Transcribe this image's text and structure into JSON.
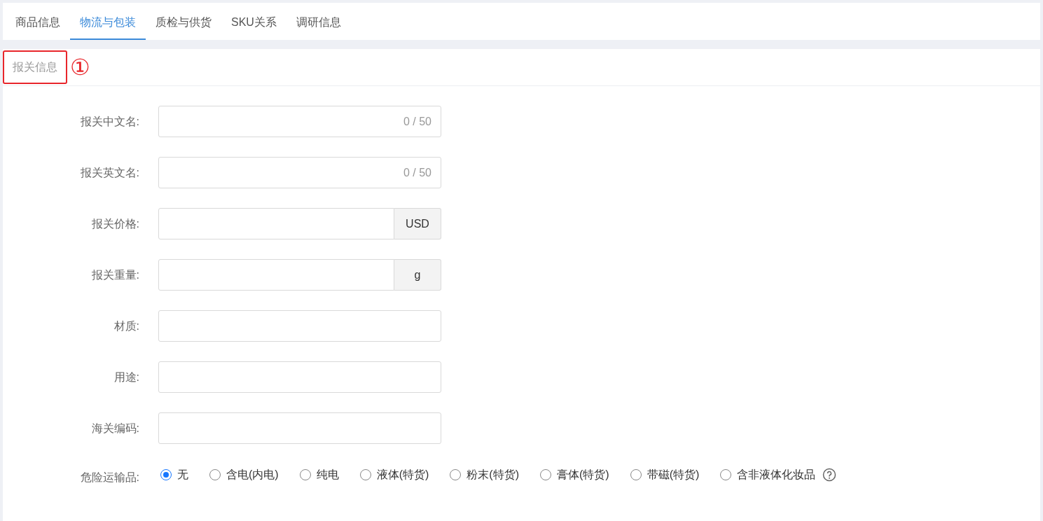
{
  "tabs": [
    {
      "label": "商品信息",
      "selected": false
    },
    {
      "label": "物流与包装",
      "selected": true
    },
    {
      "label": "质检与供货",
      "selected": false
    },
    {
      "label": "SKU关系",
      "selected": false
    },
    {
      "label": "调研信息",
      "selected": false
    }
  ],
  "section": {
    "title": "报关信息",
    "highlighted": true,
    "annotation": "①"
  },
  "fields": [
    {
      "label": "报关中文名:",
      "kind": "counter",
      "counter": "0 / 50"
    },
    {
      "label": "报关英文名:",
      "kind": "counter",
      "counter": "0 / 50"
    },
    {
      "label": "报关价格:",
      "kind": "addon",
      "suffix": "USD"
    },
    {
      "label": "报关重量:",
      "kind": "addon",
      "suffix": "g"
    },
    {
      "label": "材质:",
      "kind": "plain"
    },
    {
      "label": "用途:",
      "kind": "plain"
    },
    {
      "label": "海关编码:",
      "kind": "plain"
    }
  ],
  "dangerous_goods": {
    "label": "危险运输品:",
    "options": [
      {
        "label": "无",
        "selected": true
      },
      {
        "label": "含电(内电)",
        "selected": false
      },
      {
        "label": "纯电",
        "selected": false
      },
      {
        "label": "液体(特货)",
        "selected": false
      },
      {
        "label": "粉末(特货)",
        "selected": false
      },
      {
        "label": "膏体(特货)",
        "selected": false
      },
      {
        "label": "带磁(特货)",
        "selected": false
      },
      {
        "label": "含非液体化妆品",
        "selected": false
      }
    ]
  }
}
